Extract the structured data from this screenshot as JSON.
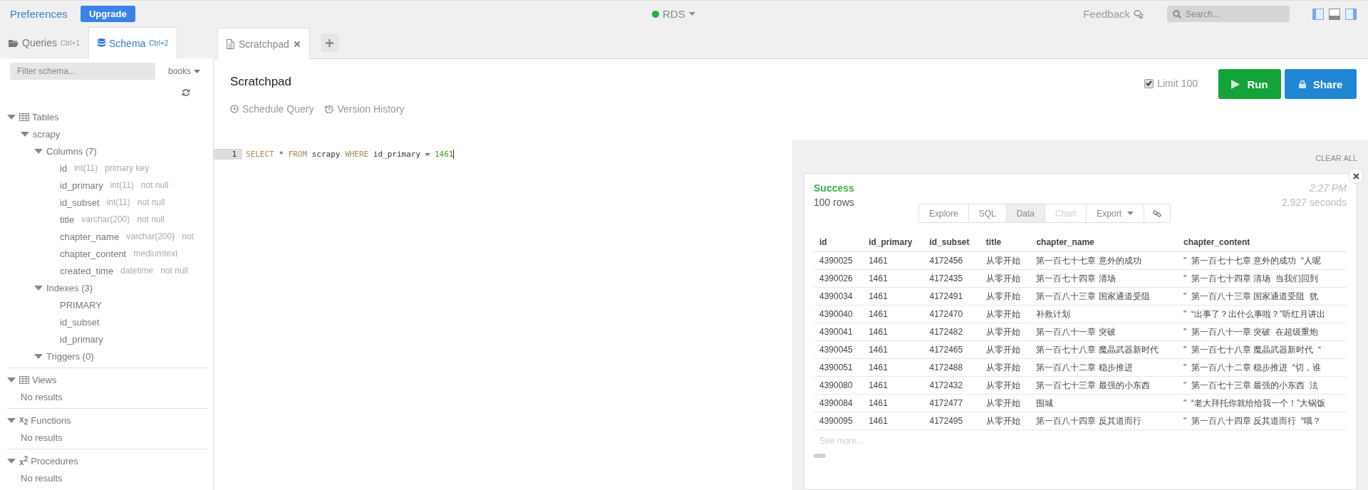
{
  "top_bar": {
    "preferences": "Preferences",
    "upgrade": "Upgrade",
    "connection": {
      "name": "RDS",
      "color": "#1db53c"
    },
    "feedback": "Feedback",
    "search": {
      "placeholder": "Search..."
    },
    "panels": [
      {
        "kind": "left",
        "on": true
      },
      {
        "kind": "bottom",
        "on": false
      },
      {
        "kind": "right",
        "on": true
      }
    ]
  },
  "sidebar": {
    "tabs": [
      {
        "label": "Queries",
        "shortcut": "Ctrl+1",
        "kind": "folder",
        "selected": false
      },
      {
        "label": "Schema",
        "shortcut": "Ctrl+2",
        "kind": "database",
        "selected": true
      }
    ],
    "filter": {
      "placeholder": "Filter schema..."
    },
    "database": "books",
    "sections": [
      {
        "label": "Tables",
        "kind": "table",
        "expanded": true,
        "children": [
          {
            "label": "scrapy",
            "expanded": true,
            "children": [
              {
                "label": "Columns (7)",
                "expanded": true,
                "children": [
                  {
                    "kind": "column",
                    "name": "id",
                    "type": "int(11)",
                    "constraint": "primary key"
                  },
                  {
                    "kind": "column",
                    "name": "id_primary",
                    "type": "int(11)",
                    "constraint": "not null"
                  },
                  {
                    "kind": "column",
                    "name": "id_subset",
                    "type": "int(11)",
                    "constraint": "not null"
                  },
                  {
                    "kind": "column",
                    "name": "title",
                    "type": "varchar(200)",
                    "constraint": "not null"
                  },
                  {
                    "kind": "column",
                    "name": "chapter_name",
                    "type": "varchar(200)",
                    "constraint": "not"
                  },
                  {
                    "kind": "column",
                    "name": "chapter_content",
                    "type": "mediumtext"
                  },
                  {
                    "kind": "column",
                    "name": "created_time",
                    "type": "datetime",
                    "constraint": "not null"
                  }
                ]
              },
              {
                "label": "Indexes (3)",
                "expanded": true,
                "children": [
                  {
                    "kind": "index",
                    "name": "PRIMARY"
                  },
                  {
                    "kind": "index",
                    "name": "id_subset"
                  },
                  {
                    "kind": "index",
                    "name": "id_primary"
                  }
                ]
              },
              {
                "label": "Triggers (0)",
                "expanded": true
              }
            ]
          }
        ]
      },
      {
        "label": "Views",
        "kind": "table",
        "expanded": true,
        "empty": "No results"
      },
      {
        "label": "Functions",
        "prefix": "x$_{2}$",
        "expanded": true,
        "empty": "No results"
      },
      {
        "label": "Procedures",
        "prefix": "x$^{2}$",
        "expanded": true,
        "empty": "No results"
      }
    ]
  },
  "editor": {
    "tabs": [
      {
        "label": "Scratchpad",
        "selected": true
      }
    ],
    "title": "Scratchpad",
    "links": [
      {
        "label": "Schedule Query",
        "kind": "clock"
      },
      {
        "label": "Version History",
        "kind": "history"
      }
    ],
    "limit": {
      "label": "Limit 100",
      "checked": true
    },
    "run": "Run",
    "share": "Share",
    "lines": [
      {
        "number": "1",
        "tokens": [
          {
            "kind": "keyword",
            "text": "SELECT"
          },
          {
            "kind": "plain",
            "text": "*"
          },
          {
            "kind": "keyword",
            "text": "FROM"
          },
          {
            "kind": "plain",
            "text": "scrapy"
          },
          {
            "kind": "keyword",
            "text": "WHERE"
          },
          {
            "kind": "plain",
            "text": "id_primary"
          },
          {
            "kind": "plain",
            "text": "="
          },
          {
            "kind": "number",
            "text": "1461"
          }
        ]
      }
    ]
  },
  "results": {
    "clear_all": "CLEAR ALL",
    "status": "Success",
    "rows_count": "100 rows",
    "time": "2:27 PM",
    "duration": "2.927 seconds",
    "views": [
      {
        "label": "Explore",
        "selected": false,
        "disabled": false
      },
      {
        "label": "SQL",
        "selected": false,
        "disabled": false
      },
      {
        "label": "Data",
        "selected": true,
        "disabled": false
      },
      {
        "label": "Chart",
        "selected": false,
        "disabled": true
      },
      {
        "label": "Export",
        "selected": false,
        "disabled": false,
        "dropdown": true
      }
    ],
    "table": {
      "columns": [
        "id",
        "id_primary",
        "id_subset",
        "title",
        "chapter_name",
        "chapter_content"
      ],
      "rows": [
        [
          "4390025",
          "1461",
          "4172456",
          "从零开始",
          "第一百七十七章 意外的成功",
          "\"  第一百七十七章 意外的成功  “人呢"
        ],
        [
          "4390026",
          "1461",
          "4172435",
          "从零开始",
          "第一百七十四章 清场",
          "\"  第一百七十四章 清场  当我们回到"
        ],
        [
          "4390034",
          "1461",
          "4172491",
          "从零开始",
          "第一百八十三章 国家通道受阻",
          "\"  第一百八十三章 国家通道受阻  犹"
        ],
        [
          "4390040",
          "1461",
          "4172470",
          "从零开始",
          "补救计划",
          "\"  “出事了？出什么事啦？”听红月讲出"
        ],
        [
          "4390041",
          "1461",
          "4172482",
          "从零开始",
          "第一百八十一章 突破",
          "\"  第一百八十一章 突破  在超级重炮"
        ],
        [
          "4390045",
          "1461",
          "4172465",
          "从零开始",
          "第一百七十八章 魔晶武器新时代",
          "\"  第一百七十八章 魔晶武器新时代  “"
        ],
        [
          "4390051",
          "1461",
          "4172488",
          "从零开始",
          "第一百八十二章 稳步推进",
          "\"  第一百八十二章 稳步推进  “切，谁"
        ],
        [
          "4390080",
          "1461",
          "4172432",
          "从零开始",
          "第一百七十三章 最强的小东西",
          "\"  第一百七十三章 最强的小东西  法"
        ],
        [
          "4390084",
          "1461",
          "4172477",
          "从零开始",
          "围城",
          "\"  “老大拜托你就给给我一个！”大锅饭"
        ],
        [
          "4390095",
          "1461",
          "4172495",
          "从零开始",
          "第一百八十四章 反其道而行",
          "\"  第一百八十四章 反其道而行  “哦？"
        ]
      ]
    },
    "see_more": "See more..."
  }
}
